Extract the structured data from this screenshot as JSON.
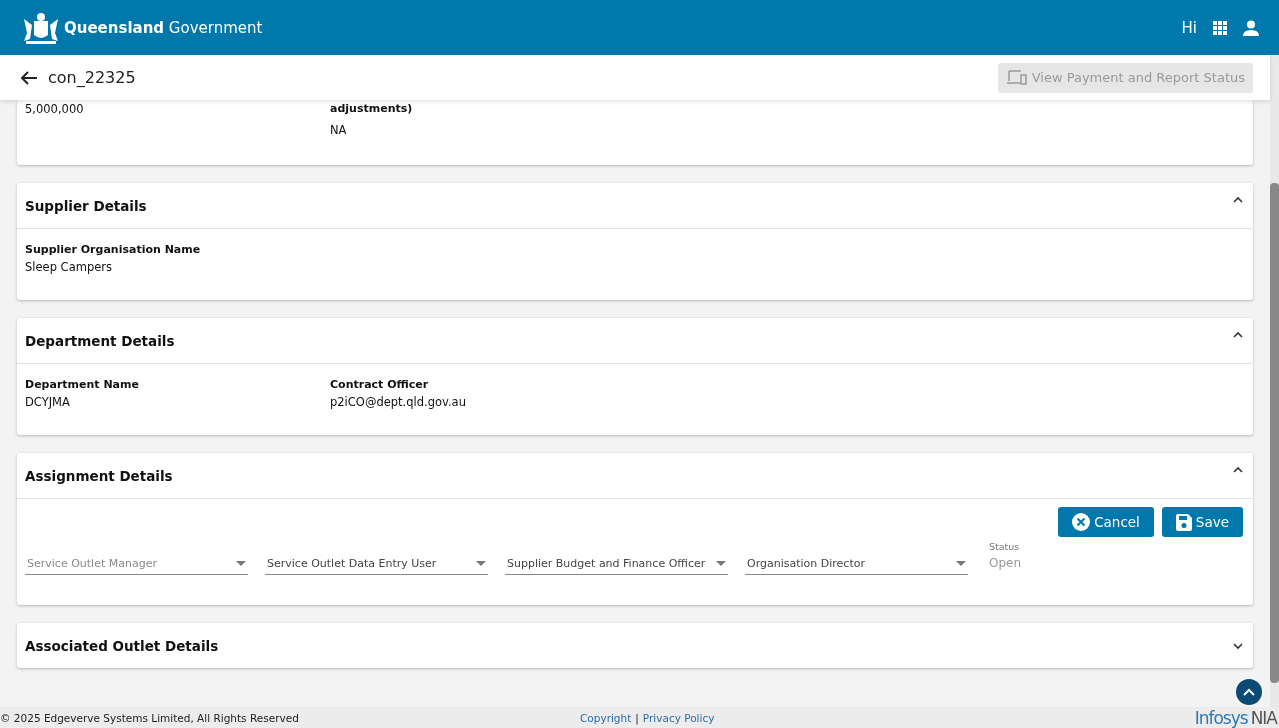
{
  "header": {
    "brand_bold": "Queensland",
    "brand_light": "Government",
    "greeting": "Hi"
  },
  "toolbar": {
    "title": "con_22325",
    "action": {
      "label": "View Payment and Report Status",
      "disabled": true
    }
  },
  "top_card": {
    "fields": [
      {
        "value": "5,000,000"
      },
      {
        "label": "adjustments)",
        "value": "NA"
      }
    ]
  },
  "sections": [
    {
      "kind": "fields",
      "title": "Supplier Details",
      "expanded": true,
      "fields": [
        {
          "label": "Supplier Organisation Name",
          "value": "Sleep Campers"
        }
      ]
    },
    {
      "kind": "fields",
      "title": "Department Details",
      "expanded": true,
      "fields": [
        {
          "label": "Department Name",
          "value": "DCYJMA"
        },
        {
          "label": "Contract Officer",
          "value": "p2iCO@dept.qld.gov.au"
        }
      ]
    },
    {
      "kind": "assignment",
      "title": "Assignment Details",
      "expanded": true,
      "buttons": [
        {
          "kind": "cancel",
          "label": "Cancel"
        },
        {
          "kind": "save",
          "label": "Save"
        }
      ],
      "dropdowns": [
        {
          "label": "Service Outlet Manager",
          "disabled": true
        },
        {
          "label": "Service Outlet Data Entry User",
          "disabled": false
        },
        {
          "label": "Supplier Budget and Finance Officer",
          "disabled": false
        },
        {
          "label": "Organisation Director",
          "disabled": false
        }
      ],
      "status": {
        "label": "Status",
        "value": "Open"
      }
    },
    {
      "title": "Associated Outlet Details",
      "expanded": false
    }
  ],
  "footer": {
    "copyright": "© 2025 Edgeverve Systems Limited, All Rights Reserved",
    "links": [
      "Copyright",
      "Privacy Policy"
    ],
    "separator": "|",
    "logo_main": "Infosys",
    "logo_sub": "NIA"
  }
}
